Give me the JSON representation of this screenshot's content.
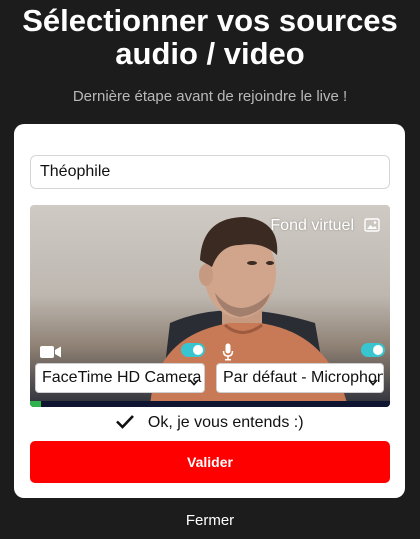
{
  "header": {
    "title_line1": "Sélectionner vos sources",
    "title_line2": "audio / video",
    "subtitle": "Dernière étape avant de rejoindre le live !"
  },
  "form": {
    "name_value": "Théophile"
  },
  "preview": {
    "virtual_background_label": "Fond virtuel",
    "camera_enabled": true,
    "microphone_enabled": true,
    "camera_select_value": "FaceTime HD Camera",
    "microphone_select_value": "Par défaut - Microphone",
    "audio_level": 0.03,
    "icons": {
      "background": "image-icon",
      "camera": "video-camera-icon",
      "microphone": "microphone-icon",
      "dropdown": "chevron-down-icon"
    }
  },
  "status": {
    "check_icon": "checkmark-icon",
    "text": "Ok, je vous entends :)"
  },
  "actions": {
    "validate_label": "Valider",
    "close_label": "Fermer"
  },
  "colors": {
    "background": "#1c1c1c",
    "accent_red": "#ff0000",
    "toggle_teal": "#39c5cf",
    "level_green": "#2fb34a"
  }
}
